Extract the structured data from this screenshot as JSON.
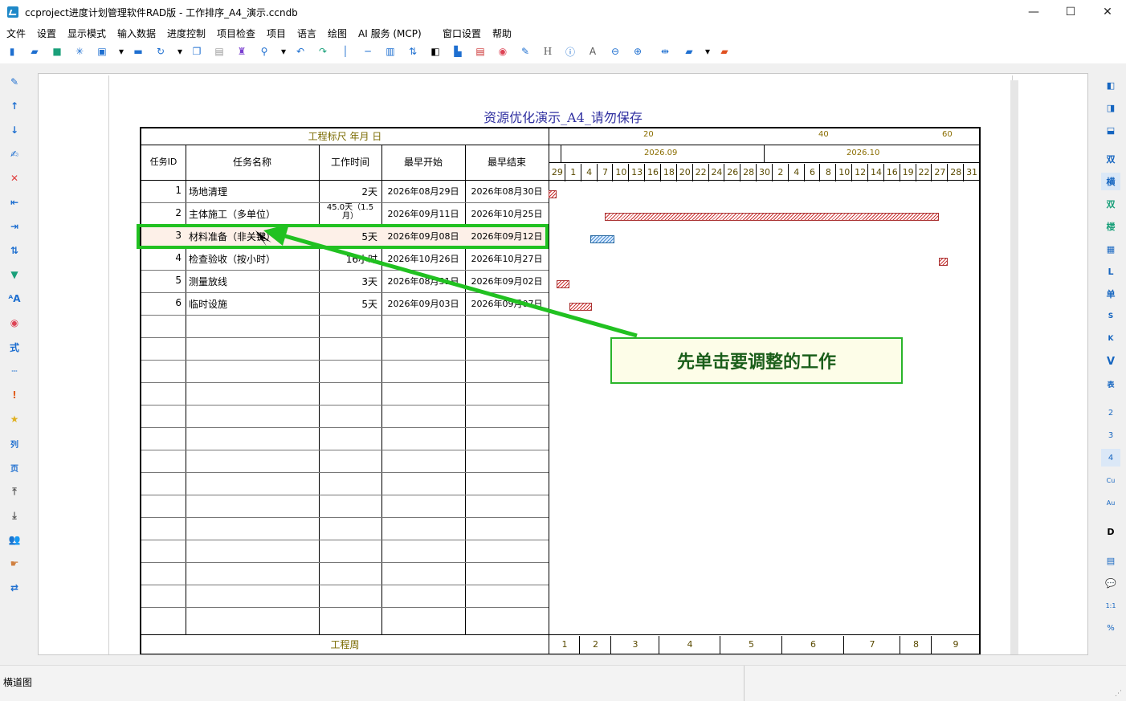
{
  "window": {
    "title": "ccproject进度计划管理软件RAD版 - 工作排序_A4_演示.ccndb",
    "minimize": "—",
    "maximize": "☐",
    "close": "✕"
  },
  "menu": [
    "文件",
    "设置",
    "显示模式",
    "输入数据",
    "进度控制",
    "项目检查",
    "项目",
    "语言",
    "绘图",
    "AI 服务 (MCP)",
    "窗口设置",
    "帮助"
  ],
  "right_toolbar": [
    "双",
    "横",
    "双",
    "楼",
    "L",
    "单",
    "S",
    "K",
    "V",
    "表",
    "2",
    "3",
    "4",
    "Cu",
    "Au",
    "D",
    "1:1",
    "%"
  ],
  "left_toolbar": [
    "列",
    "页",
    "式"
  ],
  "document": {
    "title": "资源优化演示_A4_请勿保存",
    "scale_label": "工程标尺  年月  日",
    "columns": {
      "id": "任务ID",
      "name": "任务名称",
      "duration": "工作时间",
      "start": "最早开始",
      "finish": "最早结束"
    },
    "rows": [
      {
        "id": "1",
        "name": "场地清理",
        "duration": "2天",
        "start": "2026年08月29日",
        "finish": "2026年08月30日"
      },
      {
        "id": "2",
        "name": "主体施工（多单位）",
        "duration": "45.0天（1.5月）",
        "start": "2026年09月11日",
        "finish": "2026年10月25日"
      },
      {
        "id": "3",
        "name": "材料准备（非关键）",
        "duration": "5天",
        "start": "2026年09月08日",
        "finish": "2026年09月12日"
      },
      {
        "id": "4",
        "name": "检查验收（按小时）",
        "duration": "16小时",
        "start": "2026年10月26日",
        "finish": "2026年10月27日"
      },
      {
        "id": "5",
        "name": "测量放线",
        "duration": "3天",
        "start": "2026年08月31日",
        "finish": "2026年09月02日"
      },
      {
        "id": "6",
        "name": "临时设施",
        "duration": "5天",
        "start": "2026年09月03日",
        "finish": "2026年09月07日"
      }
    ],
    "ruler_numbers": [
      "20",
      "40",
      "60"
    ],
    "months": [
      "2026.09",
      "2026.10"
    ],
    "days": [
      "29",
      "1",
      "4",
      "7",
      "10",
      "13",
      "16",
      "18",
      "20",
      "22",
      "24",
      "26",
      "28",
      "30",
      "2",
      "4",
      "6",
      "8",
      "10",
      "12",
      "14",
      "16",
      "19",
      "22",
      "27",
      "28",
      "31"
    ],
    "week_label": "工程周",
    "weeks": [
      "1",
      "2",
      "3",
      "4",
      "5",
      "6",
      "7",
      "8",
      "9"
    ]
  },
  "callout": "先单击要调整的工作",
  "status": "横道图",
  "colors": {
    "callout_border": "#2ab52a",
    "bar": "#c33333",
    "selected_bar": "#4a8ad0",
    "title": "#3030a0"
  }
}
